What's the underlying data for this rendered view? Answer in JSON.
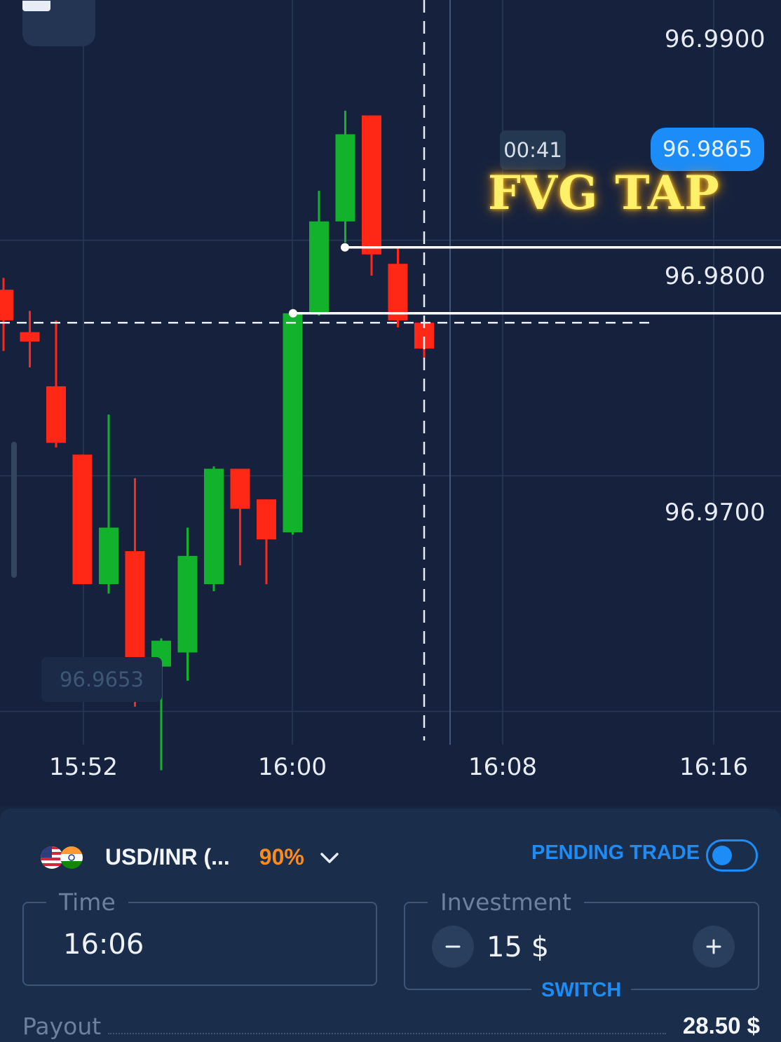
{
  "chart": {
    "price_levels": [
      "96.9900",
      "96.9800",
      "96.9700"
    ],
    "current_price": "96.9865",
    "countdown": "00:41",
    "annotation": "FVG TAP",
    "low_marker": "96.9653",
    "time_labels": [
      "15:52",
      "16:00",
      "16:08",
      "16:16"
    ]
  },
  "chart_data": {
    "type": "candlestick",
    "x_labels": [
      "15:52",
      "16:00",
      "16:08",
      "16:16"
    ],
    "ylim": [
      96.9615,
      97.0002
    ],
    "up_color": "#12b22c",
    "down_color": "#ff2716",
    "candles": [
      {
        "open": 96.9879,
        "close": 96.9866,
        "high": 96.9884,
        "low": 96.9853
      },
      {
        "open": 96.9861,
        "close": 96.9857,
        "high": 96.987,
        "low": 96.9846
      },
      {
        "open": 96.9838,
        "close": 96.9814,
        "high": 96.9866,
        "low": 96.9812
      },
      {
        "open": 96.9809,
        "close": 96.9754,
        "high": 96.9809,
        "low": 96.9754
      },
      {
        "open": 96.9754,
        "close": 96.9778,
        "high": 96.9826,
        "low": 96.975
      },
      {
        "open": 96.9768,
        "close": 96.9721,
        "high": 96.9799,
        "low": 96.9702
      },
      {
        "open": 96.9719,
        "close": 96.973,
        "high": 96.9731,
        "low": 96.9675
      },
      {
        "open": 96.9725,
        "close": 96.9766,
        "high": 96.9778,
        "low": 96.9713
      },
      {
        "open": 96.9754,
        "close": 96.9803,
        "high": 96.9804,
        "low": 96.9751
      },
      {
        "open": 96.9803,
        "close": 96.9786,
        "high": 96.9803,
        "low": 96.9762
      },
      {
        "open": 96.979,
        "close": 96.9773,
        "high": 96.979,
        "low": 96.9754
      },
      {
        "open": 96.9776,
        "close": 96.9869,
        "high": 96.9869,
        "low": 96.9775
      },
      {
        "open": 96.9869,
        "close": 96.9908,
        "high": 96.9921,
        "low": 96.9868
      },
      {
        "open": 96.9908,
        "close": 96.9945,
        "high": 96.9955,
        "low": 96.9899
      },
      {
        "open": 96.9953,
        "close": 96.9894,
        "high": 96.9953,
        "low": 96.9885
      },
      {
        "open": 96.989,
        "close": 96.9866,
        "high": 96.9897,
        "low": 96.9863
      },
      {
        "open": 96.9865,
        "close": 96.9854,
        "high": 96.9866,
        "low": 96.985
      }
    ],
    "zone_levels": [
      96.9897,
      96.9869
    ],
    "current_price": 96.9865
  },
  "trade": {
    "asset": "USD/INR (...",
    "payout_percent": "90%",
    "pending_label": "PENDING TRADE",
    "time_label": "Time",
    "time_value": "16:06",
    "investment_label": "Investment",
    "investment_value": "15 $",
    "switch_label": "SWITCH",
    "payout_label": "Payout",
    "payout_value": "28.50 $"
  }
}
